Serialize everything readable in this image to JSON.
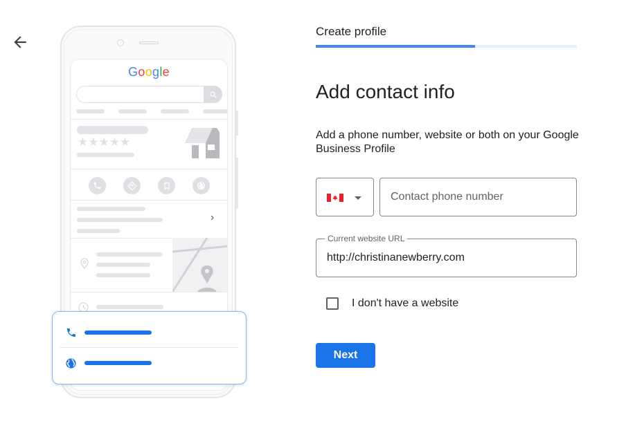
{
  "nav": {
    "back_icon": "arrow-back-icon"
  },
  "illustration": {
    "search_engine_logo": [
      {
        "char": "G",
        "color": "#4285f4"
      },
      {
        "char": "o",
        "color": "#ea4335"
      },
      {
        "char": "o",
        "color": "#fbbc05"
      },
      {
        "char": "g",
        "color": "#4285f4"
      },
      {
        "char": "l",
        "color": "#34a853"
      },
      {
        "char": "e",
        "color": "#ea4335"
      }
    ],
    "stars": "★★★★★",
    "chevron": "›",
    "action_icons": [
      "phone-icon",
      "directions-icon",
      "bookmark-icon",
      "globe-icon"
    ],
    "card_icons": [
      "phone-icon",
      "globe-icon"
    ]
  },
  "header": {
    "step_title": "Create profile",
    "progress": 0.61
  },
  "form": {
    "heading": "Add contact info",
    "subtext": "Add a phone number, website or both on your Google Business Profile",
    "country": {
      "selected": "Canada",
      "flag_icon": "canada-flag-icon"
    },
    "phone": {
      "placeholder": "Contact phone number",
      "value": ""
    },
    "website": {
      "label": "Current website URL",
      "value": "http://christinanewberry.com"
    },
    "no_website_checkbox": {
      "label": "I don't have a website",
      "checked": false
    },
    "next_label": "Next"
  },
  "colors": {
    "accent": "#1a73e8",
    "progress_fill": "#4285f4",
    "progress_track": "#e8f0fe",
    "outline": "#80868b"
  }
}
